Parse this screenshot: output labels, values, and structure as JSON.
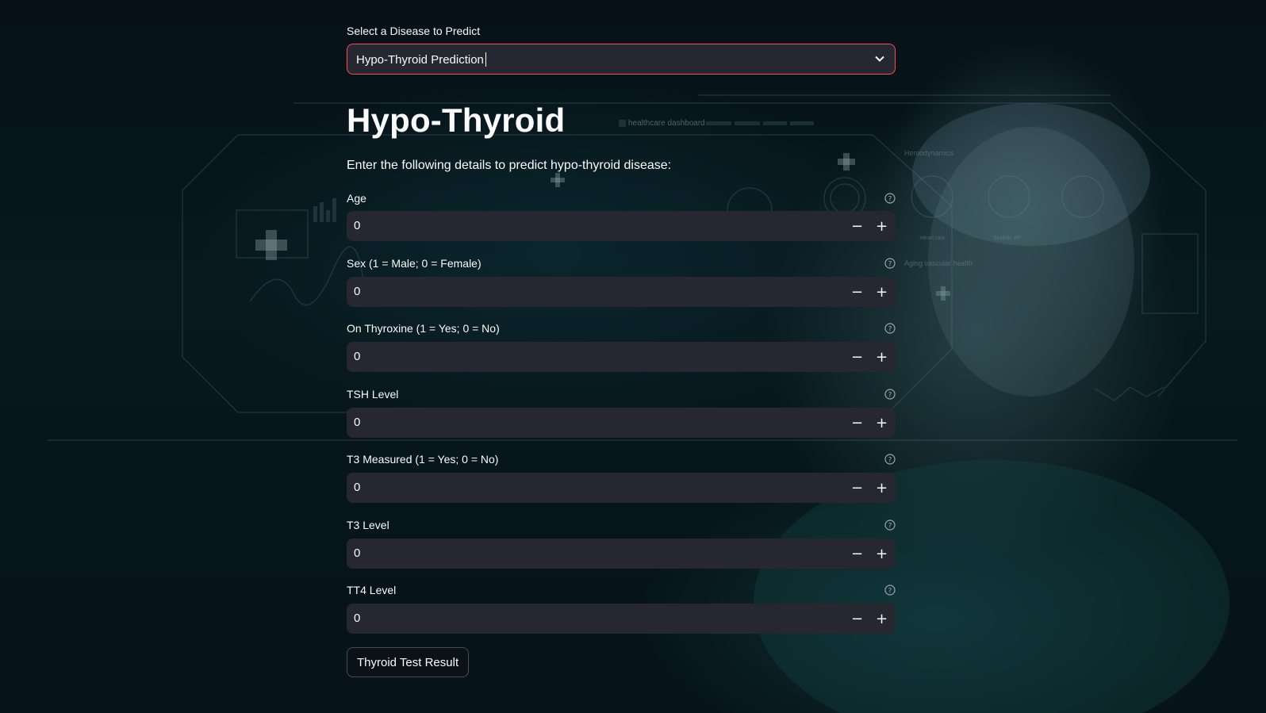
{
  "disease_select": {
    "label": "Select a Disease to Predict",
    "value": "Hypo-Thyroid Prediction"
  },
  "page": {
    "title": "Hypo-Thyroid",
    "intro": "Enter the following details to predict hypo-thyroid disease:"
  },
  "fields": [
    {
      "label": "Age",
      "value": "0"
    },
    {
      "label": "Sex (1 = Male; 0 = Female)",
      "value": "0"
    },
    {
      "label": "On Thyroxine (1 = Yes; 0 = No)",
      "value": "0"
    },
    {
      "label": "TSH Level",
      "value": "0"
    },
    {
      "label": "T3 Measured (1 = Yes; 0 = No)",
      "value": "0"
    },
    {
      "label": "T3 Level",
      "value": "0"
    },
    {
      "label": "TT4 Level",
      "value": "0"
    }
  ],
  "stepper": {
    "minus": "−",
    "plus": "+"
  },
  "submit": {
    "label": "Thyroid Test Result"
  },
  "background": {
    "hud_text": "healthcare dashboard",
    "hud_labels": [
      "Hemodynamics",
      "Aging vascular health",
      "Heart rate",
      "Systolic BP"
    ]
  },
  "colors": {
    "accent": "#ff4b4b",
    "input_bg": "#262730",
    "text": "#fafafa"
  }
}
